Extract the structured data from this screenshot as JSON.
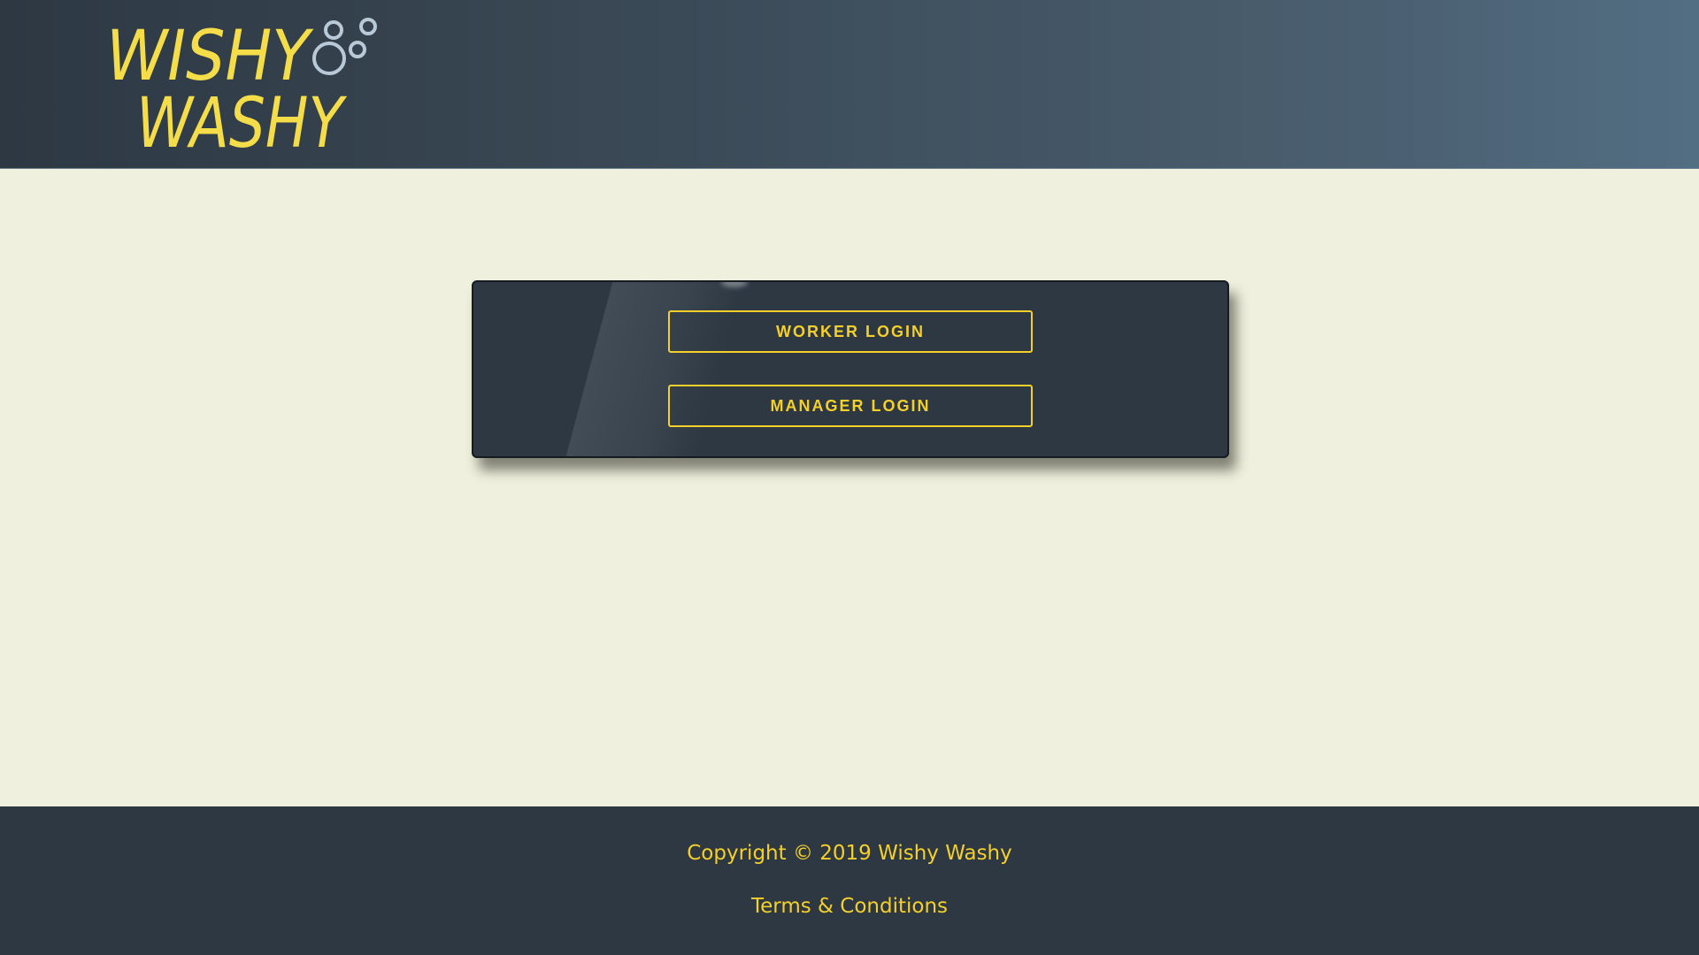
{
  "brand": {
    "logo_line1": "WISHY",
    "logo_line2": "WASHY",
    "logo_text_color": "#f5dd4a",
    "bubble_color": "#b9c9d8"
  },
  "colors": {
    "accent": "#f5cf2a",
    "panel": "#2d3843",
    "background": "#f0f0de"
  },
  "login": {
    "worker_label": "WORKER LOGIN",
    "manager_label": "MANAGER LOGIN"
  },
  "footer": {
    "copyright": "Copyright © 2019 Wishy Washy",
    "terms_label": "Terms & Conditions"
  }
}
